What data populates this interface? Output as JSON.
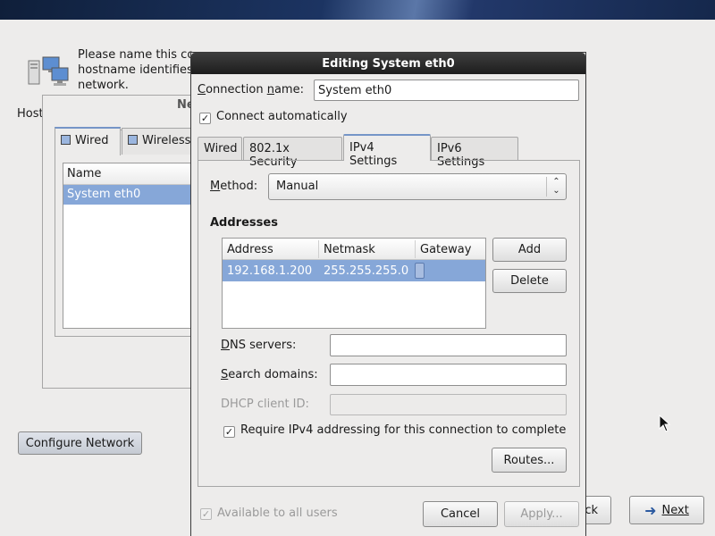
{
  "background": {
    "intro_text": "Please name this computer. The hostname identifies the computer on a network.",
    "intro_line1": "Please name this co",
    "intro_line2": "hostname identifies",
    "intro_line3": "network.",
    "hostname_label": "Host",
    "panel_title": "Ne",
    "tabs": [
      "Wired",
      "Wireless"
    ],
    "list_header": "Name",
    "list_rows": [
      "System eth0"
    ],
    "configure_button": "Configure Network",
    "back_button": "ck",
    "next_button": "Next"
  },
  "dialog": {
    "title": "Editing System eth0",
    "connection_name_label": "Connection name:",
    "connection_name_value": "System eth0",
    "connect_automatically_label": "Connect automatically",
    "connect_automatically_checked": true,
    "tabs": [
      "Wired",
      "802.1x Security",
      "IPv4 Settings",
      "IPv6 Settings"
    ],
    "active_tab": "IPv4 Settings",
    "method_label": "Method:",
    "method_value": "Manual",
    "addresses_heading": "Addresses",
    "table_headers": [
      "Address",
      "Netmask",
      "Gateway"
    ],
    "table_rows": [
      {
        "address": "192.168.1.200",
        "netmask": "255.255.255.0",
        "gateway": ""
      }
    ],
    "add_button": "Add",
    "delete_button": "Delete",
    "dns_label": "DNS servers:",
    "dns_value": "",
    "search_domains_label": "Search domains:",
    "search_domains_value": "",
    "dhcp_client_id_label": "DHCP client ID:",
    "dhcp_client_id_value": "",
    "require_ipv4_label": "Require IPv4 addressing for this connection to complete",
    "require_ipv4_checked": true,
    "routes_button": "Routes...",
    "available_all_users_label": "Available to all users",
    "available_all_users_checked": true,
    "cancel_button": "Cancel",
    "apply_button": "Apply..."
  },
  "colors": {
    "selection": "#86a7d8",
    "tab_highlight": "#7595c7",
    "titlebar": "#2a2a2a"
  }
}
